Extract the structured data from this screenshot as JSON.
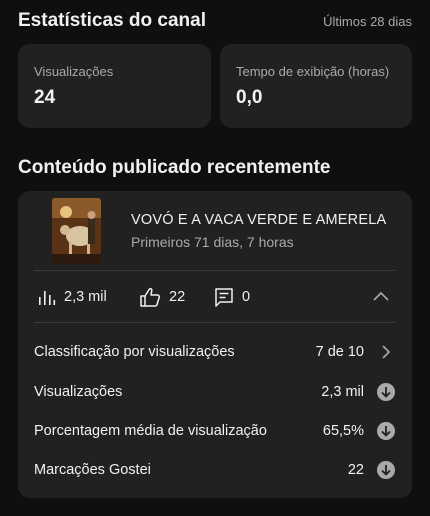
{
  "channel_stats": {
    "title": "Estatísticas do canal",
    "period": "Últimos 28 dias",
    "cards": [
      {
        "label": "Visualizações",
        "value": "24"
      },
      {
        "label": "Tempo de exibição (horas)",
        "value": "0,0"
      }
    ]
  },
  "recent_content": {
    "title": "Conteúdo publicado recentemente",
    "video": {
      "title": "VOVÓ E A VACA VERDE E AMERELA",
      "subtitle": "Primeiros 71 dias, 7 horas",
      "views": "2,3 mil",
      "likes": "22",
      "comments": "0"
    },
    "details": [
      {
        "label": "Classificação por visualizações",
        "value": "7 de 10",
        "icon": "chevron-right-icon"
      },
      {
        "label": "Visualizações",
        "value": "2,3 mil",
        "icon": "arrow-down-circle-icon"
      },
      {
        "label": "Porcentagem média de visualização",
        "value": "65,5%",
        "icon": "arrow-down-circle-icon"
      },
      {
        "label": "Marcações Gostei",
        "value": "22",
        "icon": "arrow-down-circle-icon"
      }
    ]
  },
  "colors": {
    "background": "#0f0f0f",
    "card": "#212121",
    "text_primary": "#f1f1f1",
    "text_secondary": "#aaaaaa"
  }
}
